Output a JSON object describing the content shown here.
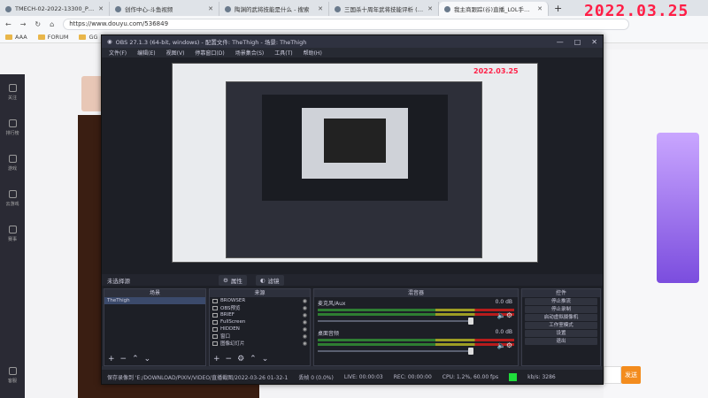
{
  "date_overlay": "2022.03.25",
  "tabs": [
    {
      "label": "TMECH-02-2022-13300_Proof_of..."
    },
    {
      "label": "创作中心-斗鱼视频"
    },
    {
      "label": "陶渊的武将技能是什么 - 搜索"
    },
    {
      "label": "三国杀十周年武将技能评析 (陶谦..."
    },
    {
      "label": "我主商跟踪(谷)直播_LOL手游直..."
    }
  ],
  "url": "https://www.douyu.com/536849",
  "bookmarks": [
    "AAA",
    "FORUM",
    "GG"
  ],
  "left_nav": [
    "关注",
    "排行榜",
    "游戏",
    "云游戏",
    "赛事",
    "客服"
  ],
  "obs": {
    "title": "OBS 27.1.3 (64-bit, windows) - 配置文件: TheThigh - 场景: TheThigh",
    "menu": [
      "文件(F)",
      "编辑(E)",
      "视图(V)",
      "停靠窗口(D)",
      "场景集合(S)",
      "工具(T)",
      "帮助(H)"
    ],
    "preview_date": "2022.03.25",
    "scene_bar": {
      "label": "未选择源",
      "props": "属性",
      "filters": "滤镜"
    },
    "docks": {
      "scenes": "场景",
      "sources": "来源",
      "mixer": "混音器",
      "controls": "控件"
    },
    "scene_items": [
      "TheThigh"
    ],
    "source_items": [
      "BROWSER",
      "OBS预览",
      "BRIEF",
      "FullScreen",
      "HIDDEN",
      "窗口",
      "图像幻灯片"
    ],
    "mixer": [
      {
        "name": "麦克风/Aux",
        "value": "0.0 dB"
      },
      {
        "name": "桌面音频",
        "value": "0.0 dB"
      }
    ],
    "controls": [
      "停止推流",
      "停止录制",
      "启动虚拟摄像机",
      "工作室模式",
      "设置",
      "退出"
    ],
    "status": {
      "recording_path": "保存录像到 'E:/DOWNLOAD/PIXIV/VIDEO/直播截图/2022-03-26 01-32-1",
      "dropped": "丢帧 0 (0.0%)",
      "live": "LIVE: 00:00:03",
      "rec": "REC: 00:00:00",
      "cpu": "CPU: 1.2%, 60.00 fps",
      "bitrate": "kb/s: 3286"
    }
  },
  "send_label": "发送"
}
